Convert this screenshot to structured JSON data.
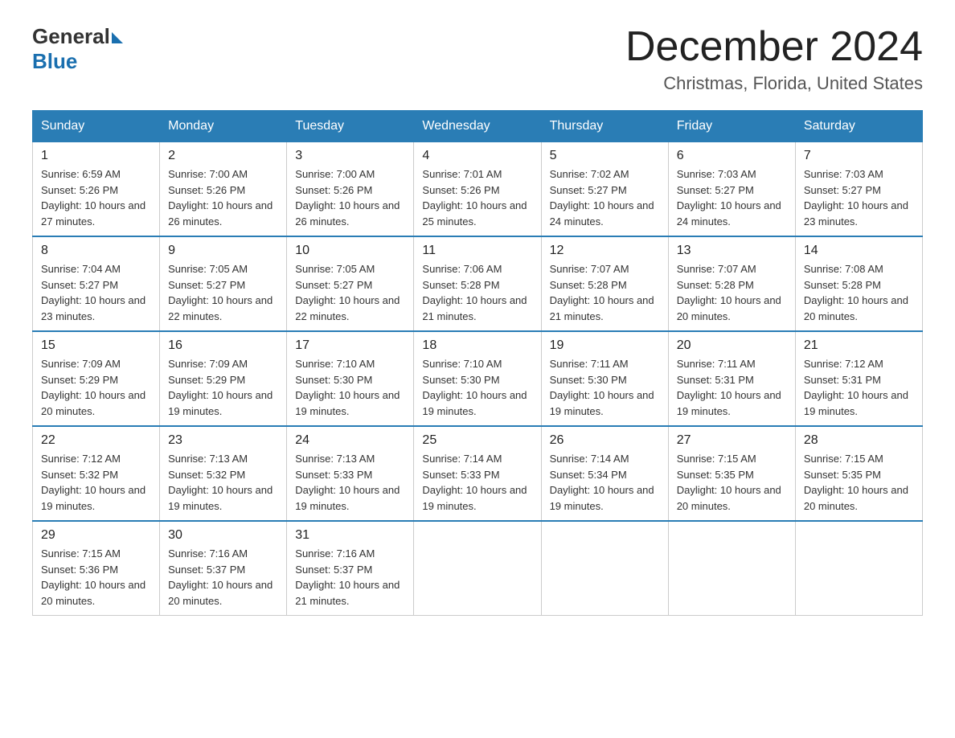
{
  "header": {
    "logo_general": "General",
    "logo_blue": "Blue",
    "month": "December 2024",
    "location": "Christmas, Florida, United States"
  },
  "days_of_week": [
    "Sunday",
    "Monday",
    "Tuesday",
    "Wednesday",
    "Thursday",
    "Friday",
    "Saturday"
  ],
  "weeks": [
    [
      {
        "day": "1",
        "sunrise": "6:59 AM",
        "sunset": "5:26 PM",
        "daylight": "10 hours and 27 minutes."
      },
      {
        "day": "2",
        "sunrise": "7:00 AM",
        "sunset": "5:26 PM",
        "daylight": "10 hours and 26 minutes."
      },
      {
        "day": "3",
        "sunrise": "7:00 AM",
        "sunset": "5:26 PM",
        "daylight": "10 hours and 26 minutes."
      },
      {
        "day": "4",
        "sunrise": "7:01 AM",
        "sunset": "5:26 PM",
        "daylight": "10 hours and 25 minutes."
      },
      {
        "day": "5",
        "sunrise": "7:02 AM",
        "sunset": "5:27 PM",
        "daylight": "10 hours and 24 minutes."
      },
      {
        "day": "6",
        "sunrise": "7:03 AM",
        "sunset": "5:27 PM",
        "daylight": "10 hours and 24 minutes."
      },
      {
        "day": "7",
        "sunrise": "7:03 AM",
        "sunset": "5:27 PM",
        "daylight": "10 hours and 23 minutes."
      }
    ],
    [
      {
        "day": "8",
        "sunrise": "7:04 AM",
        "sunset": "5:27 PM",
        "daylight": "10 hours and 23 minutes."
      },
      {
        "day": "9",
        "sunrise": "7:05 AM",
        "sunset": "5:27 PM",
        "daylight": "10 hours and 22 minutes."
      },
      {
        "day": "10",
        "sunrise": "7:05 AM",
        "sunset": "5:27 PM",
        "daylight": "10 hours and 22 minutes."
      },
      {
        "day": "11",
        "sunrise": "7:06 AM",
        "sunset": "5:28 PM",
        "daylight": "10 hours and 21 minutes."
      },
      {
        "day": "12",
        "sunrise": "7:07 AM",
        "sunset": "5:28 PM",
        "daylight": "10 hours and 21 minutes."
      },
      {
        "day": "13",
        "sunrise": "7:07 AM",
        "sunset": "5:28 PM",
        "daylight": "10 hours and 20 minutes."
      },
      {
        "day": "14",
        "sunrise": "7:08 AM",
        "sunset": "5:28 PM",
        "daylight": "10 hours and 20 minutes."
      }
    ],
    [
      {
        "day": "15",
        "sunrise": "7:09 AM",
        "sunset": "5:29 PM",
        "daylight": "10 hours and 20 minutes."
      },
      {
        "day": "16",
        "sunrise": "7:09 AM",
        "sunset": "5:29 PM",
        "daylight": "10 hours and 19 minutes."
      },
      {
        "day": "17",
        "sunrise": "7:10 AM",
        "sunset": "5:30 PM",
        "daylight": "10 hours and 19 minutes."
      },
      {
        "day": "18",
        "sunrise": "7:10 AM",
        "sunset": "5:30 PM",
        "daylight": "10 hours and 19 minutes."
      },
      {
        "day": "19",
        "sunrise": "7:11 AM",
        "sunset": "5:30 PM",
        "daylight": "10 hours and 19 minutes."
      },
      {
        "day": "20",
        "sunrise": "7:11 AM",
        "sunset": "5:31 PM",
        "daylight": "10 hours and 19 minutes."
      },
      {
        "day": "21",
        "sunrise": "7:12 AM",
        "sunset": "5:31 PM",
        "daylight": "10 hours and 19 minutes."
      }
    ],
    [
      {
        "day": "22",
        "sunrise": "7:12 AM",
        "sunset": "5:32 PM",
        "daylight": "10 hours and 19 minutes."
      },
      {
        "day": "23",
        "sunrise": "7:13 AM",
        "sunset": "5:32 PM",
        "daylight": "10 hours and 19 minutes."
      },
      {
        "day": "24",
        "sunrise": "7:13 AM",
        "sunset": "5:33 PM",
        "daylight": "10 hours and 19 minutes."
      },
      {
        "day": "25",
        "sunrise": "7:14 AM",
        "sunset": "5:33 PM",
        "daylight": "10 hours and 19 minutes."
      },
      {
        "day": "26",
        "sunrise": "7:14 AM",
        "sunset": "5:34 PM",
        "daylight": "10 hours and 19 minutes."
      },
      {
        "day": "27",
        "sunrise": "7:15 AM",
        "sunset": "5:35 PM",
        "daylight": "10 hours and 20 minutes."
      },
      {
        "day": "28",
        "sunrise": "7:15 AM",
        "sunset": "5:35 PM",
        "daylight": "10 hours and 20 minutes."
      }
    ],
    [
      {
        "day": "29",
        "sunrise": "7:15 AM",
        "sunset": "5:36 PM",
        "daylight": "10 hours and 20 minutes."
      },
      {
        "day": "30",
        "sunrise": "7:16 AM",
        "sunset": "5:37 PM",
        "daylight": "10 hours and 20 minutes."
      },
      {
        "day": "31",
        "sunrise": "7:16 AM",
        "sunset": "5:37 PM",
        "daylight": "10 hours and 21 minutes."
      },
      null,
      null,
      null,
      null
    ]
  ]
}
